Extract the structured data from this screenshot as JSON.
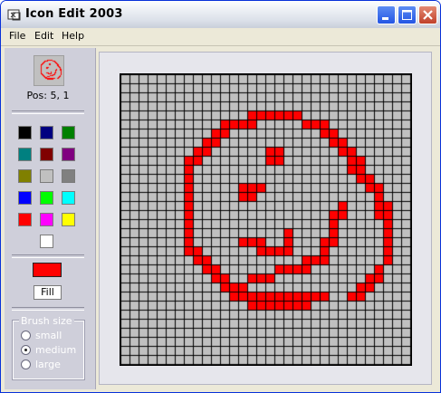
{
  "window": {
    "title": "Icon Edit 2003",
    "buttons": {
      "minimize": "minimize",
      "maximize": "maximize",
      "close": "close"
    }
  },
  "menu": [
    "File",
    "Edit",
    "Help"
  ],
  "status": {
    "pos": "Pos: 5, 1"
  },
  "palette": [
    "#000000",
    "#000080",
    "#008000",
    "#008080",
    "#800000",
    "#800080",
    "#808000",
    "#C0C0C0",
    "#808080",
    "#0000FF",
    "#00FF00",
    "#00FFFF",
    "#FF0000",
    "#FF00FF",
    "#FFFF00",
    "#FFFFFF"
  ],
  "current_color": "#FF0000",
  "fill_button": "Fill",
  "brush": {
    "legend": "Brush size",
    "options": [
      {
        "label": "small",
        "selected": false
      },
      {
        "label": "medium",
        "selected": true
      },
      {
        "label": "large",
        "selected": false
      }
    ]
  },
  "icon": {
    "size": 32,
    "background": "#C0C0C0",
    "paint": "#FF0000",
    "pixels": [
      "................................",
      "................................",
      "................................",
      "................................",
      "..............######............",
      "...........####.....###.........",
      "..........##..........##........",
      ".........##............##.......",
      "........##......##......##......",
      ".......##.......##.......##.....",
      ".......#.................##.....",
      ".......#..................##....",
      ".......#.....###...........##...",
      ".......#.....##.............#...",
      ".......#................#...##..",
      ".......#...............##...##..",
      ".......#...............#.....#..",
      ".......#..........#....#.....#..",
      ".......#.....###..#...##.....#..",
      ".......##......####...#......#..",
      "........##..........###......#..",
      ".........##......####.......#...",
      "..........##..###..........##...",
      "...........###............##....",
      "............###########..##.....",
      "..............#######...........",
      "................................",
      "................................",
      "................................",
      "................................",
      "................................",
      "................................"
    ]
  }
}
